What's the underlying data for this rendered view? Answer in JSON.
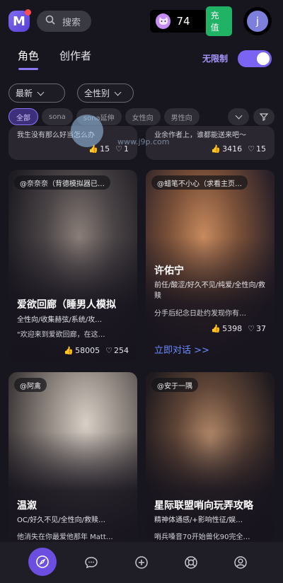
{
  "header": {
    "search_placeholder": "搜索",
    "coin_count": "74",
    "recharge_label": "充值",
    "avatar_letter": "j"
  },
  "tabs": [
    {
      "label": "角色",
      "active": true
    },
    {
      "label": "创作者",
      "active": false
    }
  ],
  "unlimited": {
    "label": "无限制",
    "enabled": true
  },
  "filters": {
    "sort": "最新",
    "gender": "全性别"
  },
  "tags": [
    "全部",
    "sona",
    "sona延伸",
    "女性向",
    "男性向"
  ],
  "top_partial_cards": [
    {
      "desc": "我生没有那么好当怎么办",
      "likes": "15",
      "hearts": "1"
    },
    {
      "desc": "业余作者上，谁都能送来吧～",
      "likes": "3416",
      "hearts": "15"
    }
  ],
  "cards": [
    {
      "creator": "@奈奈奈（背德模拟器已…",
      "title": "爱欲回廊（睡男人模拟",
      "tags": "全性向/收集赫弦/系统/攻…",
      "desc": "\"欢迎来到爱欲回廊，在这…",
      "likes": "58005",
      "hearts": "254"
    },
    {
      "creator": "@蜡笔不小心（求看主页…",
      "title": "许佑宁",
      "tags": "前任/酸涩/好久不见/纯爱/全性向/救赎",
      "desc": "分手后纪念日赴约发现你有…",
      "likes": "5398",
      "hearts": "37",
      "cta": "立即对话 >>"
    },
    {
      "creator": "@阿禽",
      "title": "温溆",
      "tags": "OC/好久不见/全性向/救赎…",
      "desc": "他消失在你最爱他那年 Matt…"
    },
    {
      "creator": "@安于一隅",
      "title": "星际联盟哨向玩弄攻略",
      "tags": "精神体通感/+影响性征/娱…",
      "desc": "哨兵嗓音70开始兽化90完全…"
    }
  ],
  "watermark": {
    "text": "www.j9p.com"
  },
  "colors": {
    "accent": "#7b64f2",
    "link": "#6c8bff",
    "recharge": "#20b366",
    "background": "#17161f"
  }
}
